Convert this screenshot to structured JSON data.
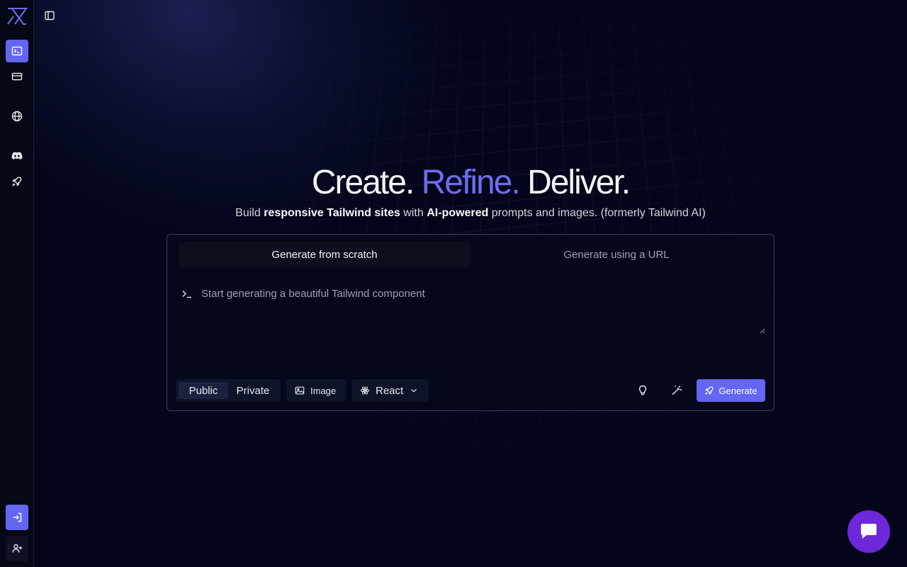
{
  "sidebar": {
    "logo": "tailwind-ai-logo",
    "items": [
      {
        "icon": "terminal-icon",
        "active": true
      },
      {
        "icon": "credit-card-icon",
        "active": false
      },
      {
        "icon": "globe-icon",
        "active": false
      },
      {
        "icon": "discord-icon",
        "active": false
      },
      {
        "icon": "rocket-icon",
        "active": false
      }
    ],
    "bottom": [
      {
        "icon": "sign-in-icon"
      },
      {
        "icon": "user-plus-icon"
      }
    ]
  },
  "hero": {
    "title_part1": "Create.",
    "title_part2": "Refine.",
    "title_part3": "Deliver.",
    "sub_pre": "Build ",
    "sub_bold1": "responsive Tailwind sites",
    "sub_mid": " with ",
    "sub_bold2": "AI-powered",
    "sub_post": " prompts and images. (formerly Tailwind AI)"
  },
  "tabs": [
    {
      "label": "Generate from scratch",
      "active": true
    },
    {
      "label": "Generate using a URL",
      "active": false
    }
  ],
  "prompt": {
    "placeholder": "Start generating a beautiful Tailwind component",
    "value": ""
  },
  "visibility": {
    "options": [
      "Public",
      "Private"
    ],
    "selected": "Public"
  },
  "image_button": {
    "label": "Image"
  },
  "framework": {
    "selected": "React"
  },
  "generate_button": {
    "label": "Generate"
  },
  "colors": {
    "accent": "#6366f1",
    "chat": "#6d28d9",
    "background": "#03061a"
  }
}
